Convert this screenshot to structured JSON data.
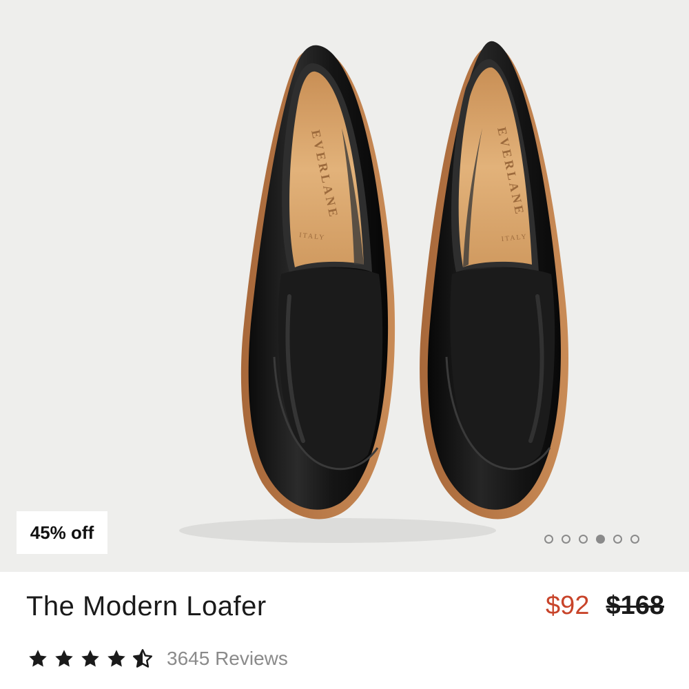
{
  "product": {
    "name": "The Modern Loafer",
    "discount_badge": "45% off",
    "sale_price": "$92",
    "original_price": "$168",
    "rating": 4.5,
    "rating_max": 5,
    "reviews_label": "3645 Reviews",
    "insole_brand": "EVERLANE",
    "insole_origin": "ITALY"
  },
  "carousel": {
    "total": 6,
    "active_index": 3
  },
  "colors": {
    "sale_price": "#c8442a",
    "image_background": "#eeeeec",
    "leather": "#141414",
    "insole": "#d9a56a",
    "sole": "#b8794a"
  }
}
